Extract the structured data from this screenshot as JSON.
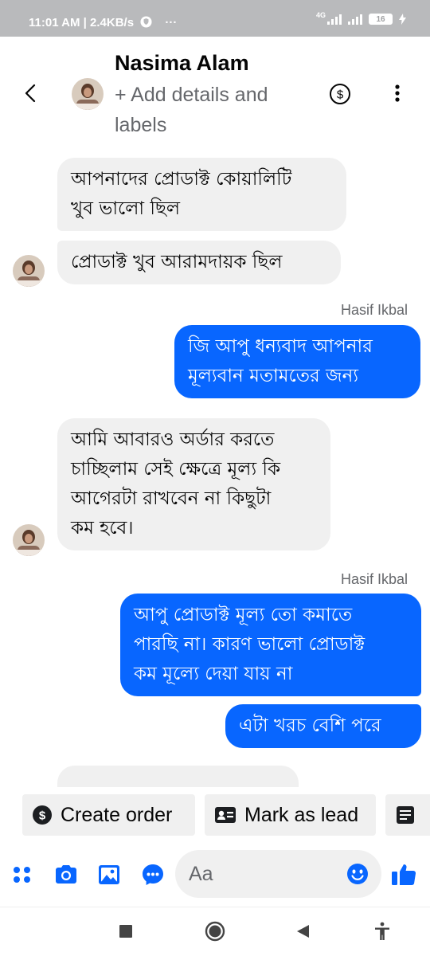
{
  "status_bar": {
    "time_speed": "11:01 AM | 2.4KB/s",
    "dots": "···",
    "network": "4G",
    "battery": "16"
  },
  "header": {
    "name": "Nasima Alam",
    "add_details": "+ Add details and labels",
    "back_icon": "chevron-left-icon",
    "dollar_icon": "dollar-circle-icon",
    "more_icon": "vertical-dots-icon"
  },
  "messages": [
    {
      "direction": "incoming",
      "text": "আপনাদের প্রোডাক্ট কোয়ালিটি\nখুব ভালো ছিল"
    },
    {
      "direction": "incoming",
      "text": "প্রোডাক্ট খুব আরামদায়ক ছিল"
    },
    {
      "direction": "outgoing",
      "sender": "Hasif Ikbal",
      "text": "জি আপু ধন্যবাদ আপনার\nমূল্যবান মতামতের জন্য"
    },
    {
      "direction": "incoming",
      "text": "আমি আবারও অর্ডার করতে\nচাচ্ছিলাম সেই ক্ষেত্রে মূল্য কি\nআগেরটা রাখবেন না কিছুটা\nকম হবে।"
    },
    {
      "direction": "outgoing",
      "sender": "Hasif Ikbal",
      "text": "আপু প্রোডাক্ট মূল্য তো কমাতে\nপারছি না। কারণ ভালো প্রোডাক্ট\nকম মূল্যে দেয়া যায় না"
    },
    {
      "direction": "outgoing",
      "text": "এটা খরচ বেশি পরে"
    }
  ],
  "quick_actions": [
    {
      "label": "Create order",
      "icon": "dollar-circle-icon"
    },
    {
      "label": "Mark as lead",
      "icon": "contact-card-icon"
    },
    {
      "label": "",
      "icon": "notes-icon"
    }
  ],
  "composer": {
    "placeholder": "Aa",
    "tools": [
      "apps-grid-icon",
      "camera-icon",
      "gallery-icon",
      "chat-bubble-icon"
    ],
    "emoji_icon": "emoji-icon",
    "like_icon": "thumbs-up-icon"
  },
  "nav": [
    "recents-square-icon",
    "home-circle-icon",
    "back-triangle-icon",
    "accessibility-icon"
  ],
  "colors": {
    "accent": "#0866ff",
    "incoming_bubble": "#f0f0f0",
    "status_bar": "#b9babc",
    "secondary_text": "#65676b"
  }
}
